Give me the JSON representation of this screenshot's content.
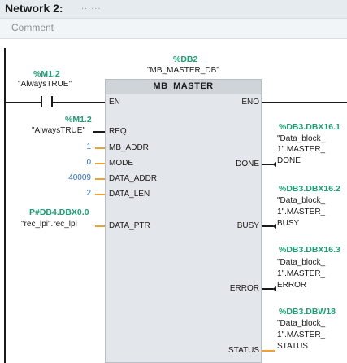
{
  "network": {
    "title": "Network 2:",
    "dots": "......",
    "comment": "Comment"
  },
  "block": {
    "instance_address": "%DB2",
    "instance_name": "\"MB_MASTER_DB\"",
    "title": "MB_MASTER",
    "pins": {
      "en": "EN",
      "eno": "ENO",
      "req": "REQ",
      "mb_addr": "MB_ADDR",
      "mode": "MODE",
      "data_addr": "DATA_ADDR",
      "data_len": "DATA_LEN",
      "data_ptr": "DATA_PTR",
      "done": "DONE",
      "busy": "BUSY",
      "error": "ERROR",
      "status": "STATUS"
    }
  },
  "contact": {
    "address": "%M1.2",
    "name": "\"AlwaysTRUE\""
  },
  "inputs": {
    "req_address": "%M1.2",
    "req_name": "\"AlwaysTRUE\"",
    "mb_addr": "1",
    "mode": "0",
    "data_addr": "40009",
    "data_len": "2",
    "data_ptr_address": "P#DB4.DBX0.0",
    "data_ptr_name": "\"rec_lpi\".rec_lpi"
  },
  "outputs": {
    "done": {
      "address": "%DB3.DBX16.1",
      "line1": "\"Data_block_",
      "line2": "1\".MASTER_",
      "line3": "DONE"
    },
    "busy": {
      "address": "%DB3.DBX16.2",
      "line1": "\"Data_block_",
      "line2": "1\".MASTER_",
      "line3": "BUSY"
    },
    "error": {
      "address": "%DB3.DBX16.3",
      "line1": "\"Data_block_",
      "line2": "1\".MASTER_",
      "line3": "ERROR"
    },
    "status": {
      "address": "%DB3.DBW18",
      "line1": "\"Data_block_",
      "line2": "1\".MASTER_",
      "line3": "STATUS"
    }
  }
}
